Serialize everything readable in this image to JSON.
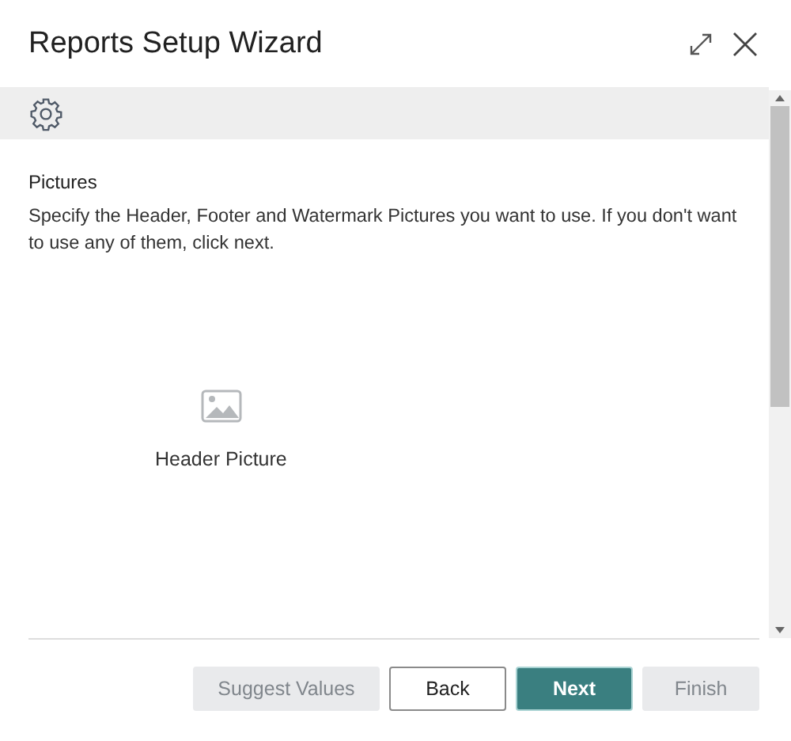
{
  "window": {
    "title": "Reports Setup Wizard"
  },
  "section": {
    "title": "Pictures",
    "description": "Specify the Header, Footer and Watermark Pictures you want to use. If you don't want to use any of them, click next."
  },
  "picture_field": {
    "label": "Header Picture"
  },
  "buttons": [
    {
      "label": "Suggest Values",
      "kind": "secondary",
      "disabled": true
    },
    {
      "label": "Back",
      "kind": "secondary",
      "disabled": false
    },
    {
      "label": "Next",
      "kind": "primary",
      "disabled": false
    },
    {
      "label": "Finish",
      "kind": "secondary",
      "disabled": true
    }
  ]
}
